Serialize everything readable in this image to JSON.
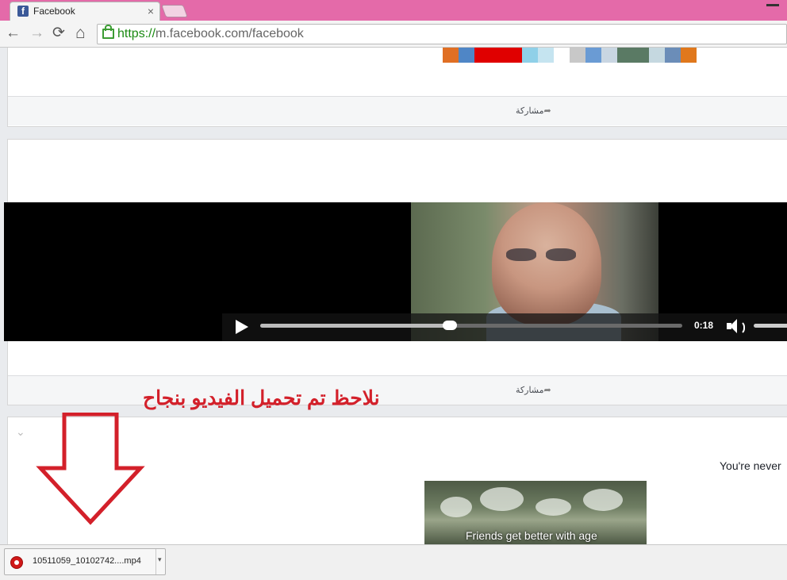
{
  "browser": {
    "tab_title": "Facebook",
    "tab_favicon": "f",
    "tab_close": "×",
    "url_scheme": "https://",
    "url_rest": "m.facebook.com/facebook",
    "nav": {
      "back": "←",
      "forward": "→",
      "reload": "⟳",
      "home": "⌂"
    }
  },
  "feed": {
    "share_label": "مشاركة",
    "share_arrow": "➦",
    "mosaic_colors": [
      "#e06f24",
      "#4f86c6",
      "#e00000",
      "#e00000",
      "#e00000",
      "#8fd0e8",
      "#c5e4f0",
      "#ffffff",
      "#c8c8c8",
      "#6a9bd4",
      "#c9d6e2",
      "#5a7a64",
      "#5a7a64",
      "#c5d8e0",
      "#6b8db8",
      "#e0781c"
    ],
    "video": {
      "time": "0:18",
      "progress": 0.45
    },
    "third_post": {
      "chevron": "⌄",
      "snippet": "You're never",
      "thumb_caption": "Friends get better with age"
    }
  },
  "annotation": {
    "text": "نلاحظ تم تحميل الفيديو بنجاح",
    "color": "#d3202a"
  },
  "downloads": {
    "file_name": "10511059_10102742....mp4",
    "caret": "▾"
  }
}
